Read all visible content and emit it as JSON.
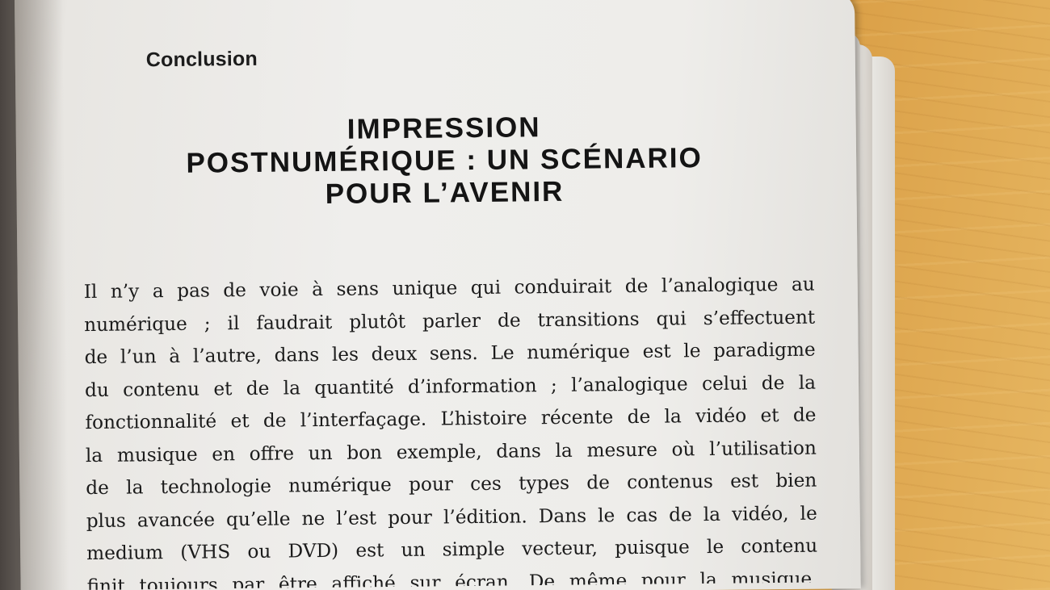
{
  "page": {
    "section_label": "Conclusion",
    "title_lines": [
      "IMPRESSION",
      "POSTNUMÉRIQUE : UN SCÉNARIO",
      "POUR L’AVENIR"
    ],
    "body_lines": [
      "Il n’y a pas de voie à sens unique qui conduirait de l’analogique au",
      "numérique ; il faudrait plutôt parler de transitions qui s’effectuent",
      "de l’un à l’autre, dans les deux sens. Le numérique est le paradigme",
      "du contenu et de la quantité d’information ; l’analogique celui de la",
      "fonctionnalité et de l’interfaçage. L’histoire récente de la vidéo et de",
      "la musique en offre un bon exemple, dans la mesure où l’utilisation",
      "de la technologie numérique pour ces types de contenus est bien",
      "plus avancée qu’elle ne l’est pour l’édition. Dans le cas de la vidéo, le",
      "medium (VHS ou DVD) est un simple vecteur, puisque le contenu",
      "finit toujours par être affiché sur écran. De même pour la musique,"
    ]
  }
}
